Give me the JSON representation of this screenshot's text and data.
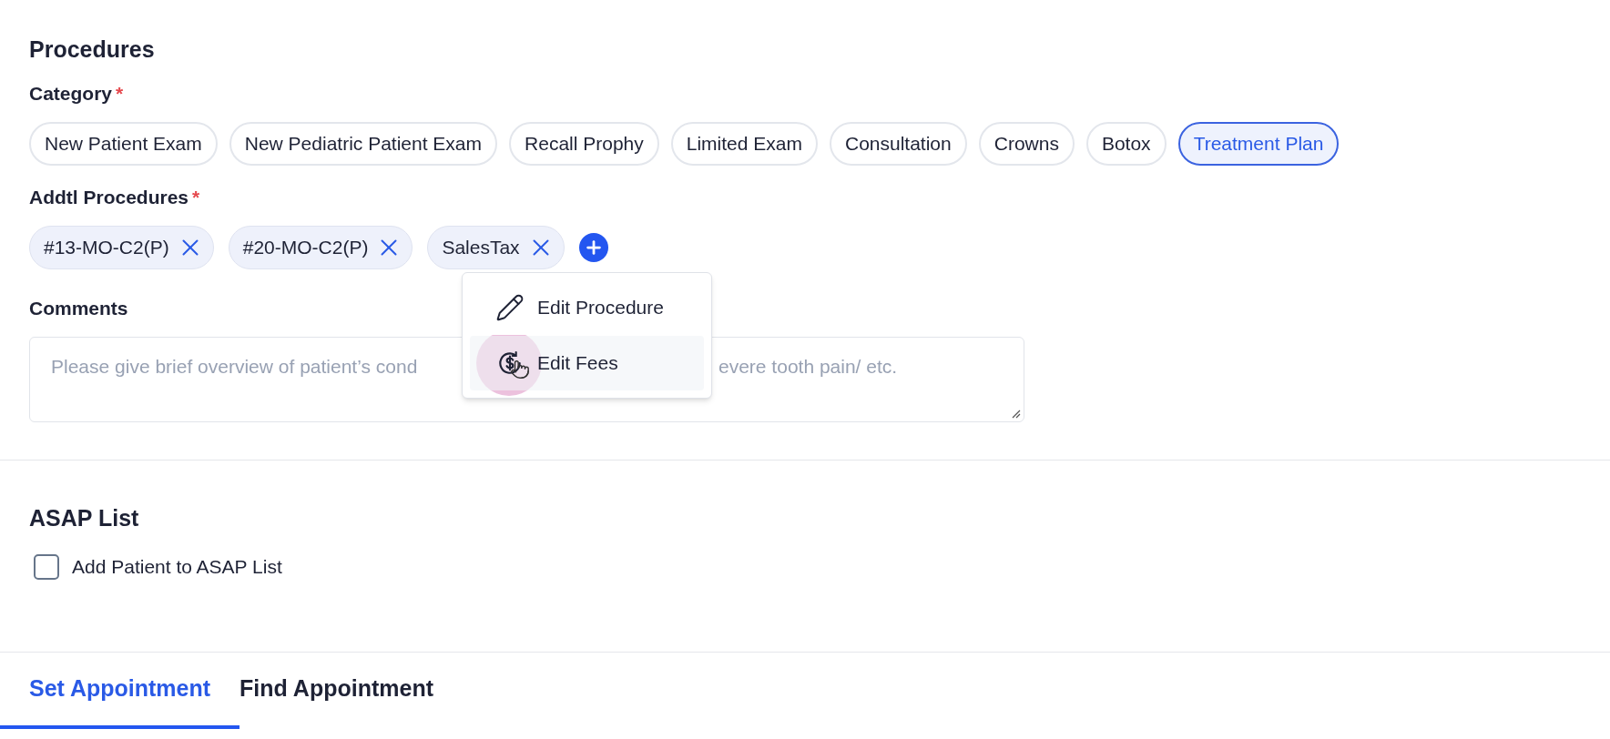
{
  "procedures": {
    "title": "Procedures",
    "category": {
      "label": "Category",
      "required_mark": "*",
      "options": [
        {
          "label": "New Patient Exam",
          "selected": false
        },
        {
          "label": "New Pediatric Patient Exam",
          "selected": false
        },
        {
          "label": "Recall Prophy",
          "selected": false
        },
        {
          "label": "Limited Exam",
          "selected": false
        },
        {
          "label": "Consultation",
          "selected": false
        },
        {
          "label": "Crowns",
          "selected": false
        },
        {
          "label": "Botox",
          "selected": false
        },
        {
          "label": "Treatment Plan",
          "selected": true
        }
      ]
    },
    "addtl": {
      "label": "Addtl Procedures",
      "required_mark": "*",
      "tags": [
        {
          "label": "#13-MO-C2(P)"
        },
        {
          "label": "#20-MO-C2(P)"
        },
        {
          "label": "SalesTax"
        }
      ]
    },
    "menu": {
      "items": [
        {
          "label": "Edit Procedure",
          "kind": "edit",
          "highlighted": false
        },
        {
          "label": "Edit Fees",
          "kind": "fees",
          "highlighted": true
        }
      ]
    },
    "comments": {
      "label": "Comments",
      "placeholder_start": "Please give brief overview of patient’s cond",
      "placeholder_end": "evere tooth pain/ etc."
    }
  },
  "asap": {
    "title": "ASAP List",
    "checkbox": {
      "label": "Add Patient to ASAP List",
      "checked": false
    }
  },
  "tabs": [
    {
      "label": "Set Appointment",
      "selected": true
    },
    {
      "label": "Find Appointment",
      "selected": false
    }
  ]
}
